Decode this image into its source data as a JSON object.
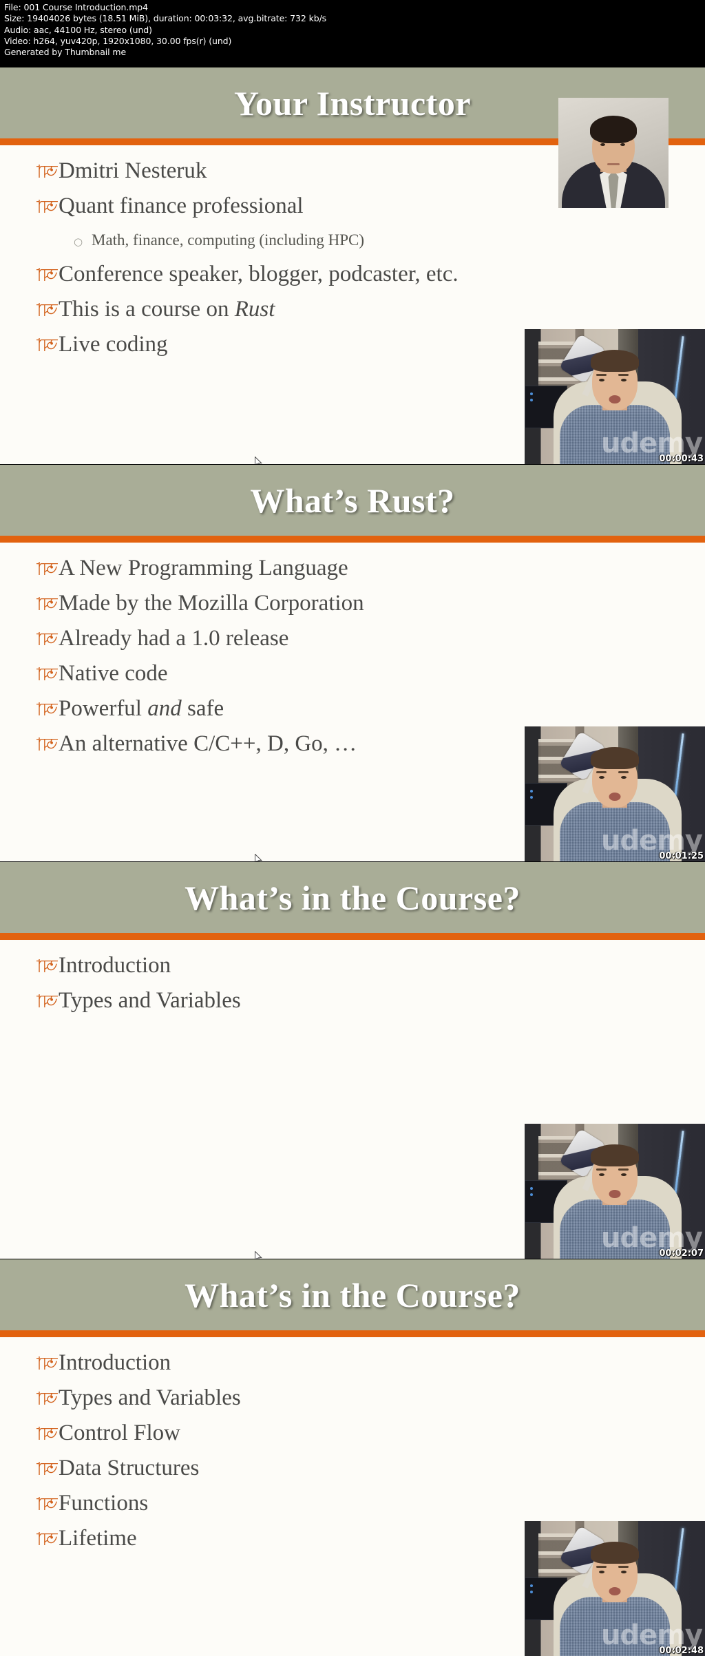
{
  "info_header": {
    "lines": [
      "File: 001 Course Introduction.mp4",
      "Size: 19404026 bytes (18.51 MiB), duration: 00:03:32, avg.bitrate: 732 kb/s",
      "Audio: aac, 44100 Hz, stereo (und)",
      "Video: h264, yuv420p, 1920x1080, 30.00 fps(r) (und)",
      "Generated by Thumbnail me"
    ],
    "file": "File: 001 Course Introduction.mp4",
    "size": "Size: 19404026 bytes (18.51 MiB), duration: 00:03:32, avg.bitrate: 732 kb/s",
    "audio": "Audio: aac, 44100 Hz, stereo (und)",
    "video": "Video: h264, yuv420p, 1920x1080, 30.00 fps(r) (und)",
    "generator": "Generated by Thumbnail me"
  },
  "colors": {
    "title_bar": "#a9ad97",
    "accent_rule": "#e2620f",
    "bullet_mark": "#d2601a",
    "slide_bg": "#fdfcf8",
    "body_text": "#4a4a48",
    "header_bg": "#000000",
    "header_text": "#ffffff"
  },
  "icons": {
    "bullet_level1": "আ",
    "bullet_level2": "○",
    "watermark": "udemy"
  },
  "frames": [
    {
      "timestamp": "00:00:43",
      "watermark": "udemy",
      "slide": {
        "title": "Your Instructor",
        "has_headshot": true,
        "bullets": [
          {
            "level": 1,
            "text": "Dmitri Nesteruk"
          },
          {
            "level": 1,
            "text": "Quant finance professional"
          },
          {
            "level": 2,
            "text": "Math, finance, computing (including HPC)"
          },
          {
            "level": 1,
            "text": "Conference speaker, blogger, podcaster, etc."
          },
          {
            "level": 1,
            "text": "This is a course on ",
            "em": "Rust"
          },
          {
            "level": 1,
            "text": "Live coding"
          }
        ]
      }
    },
    {
      "timestamp": "00:01:25",
      "watermark": "udemy",
      "slide": {
        "title": "What’s Rust?",
        "has_headshot": false,
        "bullets": [
          {
            "level": 1,
            "text": "A New Programming Language"
          },
          {
            "level": 1,
            "text": "Made by the Mozilla Corporation"
          },
          {
            "level": 1,
            "text": "Already had a 1.0 release"
          },
          {
            "level": 1,
            "text": "Native code"
          },
          {
            "level": 1,
            "text": "Powerful ",
            "em": "and",
            "tail": " safe"
          },
          {
            "level": 1,
            "text": "An alternative C/C++, D, Go, …"
          }
        ]
      }
    },
    {
      "timestamp": "00:02:07",
      "watermark": "udemy",
      "slide": {
        "title": "What’s in the Course?",
        "has_headshot": false,
        "bullets": [
          {
            "level": 1,
            "text": "Introduction"
          },
          {
            "level": 1,
            "text": "Types and Variables"
          }
        ]
      }
    },
    {
      "timestamp": "00:02:48",
      "watermark": "udemy",
      "slide": {
        "title": "What’s in the Course?",
        "has_headshot": false,
        "bullets": [
          {
            "level": 1,
            "text": "Introduction"
          },
          {
            "level": 1,
            "text": "Types and Variables"
          },
          {
            "level": 1,
            "text": "Control Flow"
          },
          {
            "level": 1,
            "text": "Data Structures"
          },
          {
            "level": 1,
            "text": "Functions"
          },
          {
            "level": 1,
            "text": "Lifetime"
          }
        ]
      }
    }
  ]
}
